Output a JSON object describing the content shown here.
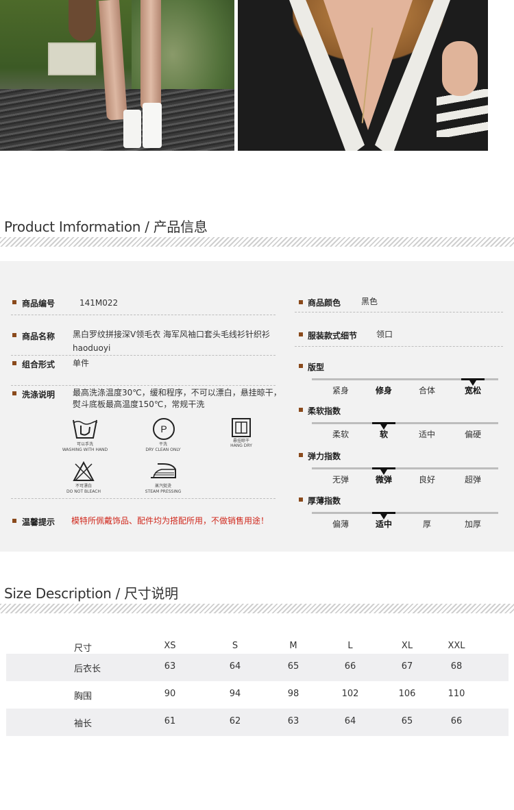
{
  "product_info": {
    "title": "Product Imformation / 产品信息",
    "item_no": {
      "label": "商品编号",
      "value": "141M022"
    },
    "item_name": {
      "label": "商品名称",
      "value": "黑白罗纹拼接深V领毛衣 海军风袖口套头毛线衫针织衫",
      "value2": "haoduoyi"
    },
    "combination": {
      "label": "组合形式",
      "value": "单件"
    },
    "wash": {
      "label": "洗涤说明",
      "value": "最高洗涤温度30℃，缓和程序，不可以漂白，悬挂晾干，",
      "value2": "熨斗底板最高温度150℃，常规干洗"
    },
    "care_icons": [
      {
        "icon": "hand-wash-icon",
        "caption1": "可以手洗",
        "caption2": "WASHING WITH HAND"
      },
      {
        "icon": "dry-clean-icon",
        "caption1": "干洗",
        "caption2": "DRY CLEAN ONLY"
      },
      {
        "icon": "hang-dry-icon",
        "caption1": "悬挂晾干",
        "caption2": "HANG DRY"
      },
      {
        "icon": "do-not-bleach-icon",
        "caption1": "不可漂白",
        "caption2": "DO NOT BLEACH"
      },
      {
        "icon": "steam-iron-icon",
        "caption1": "蒸汽熨烫",
        "caption2": "STEAM PRESSING"
      }
    ],
    "tip": {
      "label": "温馨提示",
      "value": "模特所佩戴饰品、配件均为搭配所用，不做销售用途！"
    },
    "color": {
      "label": "商品颜色",
      "value": "黑色"
    },
    "detail": {
      "label": "服装款式细节",
      "value": "领口"
    },
    "scales": [
      {
        "label": "版型",
        "options": [
          "紧身",
          "修身",
          "合体",
          "宽松"
        ],
        "selected": 3
      },
      {
        "label": "柔软指数",
        "options": [
          "柔软",
          "软",
          "适中",
          "偏硬"
        ],
        "selected": 1
      },
      {
        "label": "弹力指数",
        "options": [
          "无弹",
          "微弹",
          "良好",
          "超弹"
        ],
        "selected": 1
      },
      {
        "label": "厚薄指数",
        "options": [
          "偏薄",
          "适中",
          "厚",
          "加厚"
        ],
        "selected": 1
      }
    ]
  },
  "size": {
    "title": "Size Description / 尺寸说明",
    "header": [
      "尺寸",
      "XS",
      "S",
      "M",
      "L",
      "XL",
      "XXL"
    ],
    "rows": [
      [
        "后衣长",
        "63",
        "64",
        "65",
        "66",
        "67",
        "68"
      ],
      [
        "胸围",
        "90",
        "94",
        "98",
        "102",
        "106",
        "110"
      ],
      [
        "袖长",
        "61",
        "62",
        "63",
        "64",
        "65",
        "66"
      ]
    ]
  },
  "colors": {
    "bullet": "#8a4a1c",
    "warning": "#d0281c",
    "panel": "#f2f2f2"
  }
}
